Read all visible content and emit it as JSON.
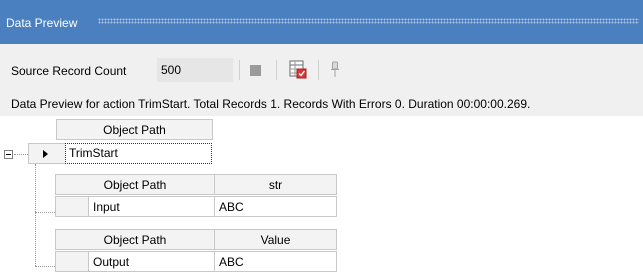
{
  "panel": {
    "title": "Data Preview"
  },
  "toolbar": {
    "source_record_count_label": "Source Record Count",
    "source_record_count_value": "500",
    "stop_icon": "stop-icon",
    "grid_icon": "grid-check-icon",
    "pin_icon": "pin-icon"
  },
  "status": {
    "message": "Data Preview for action TrimStart. Total Records 1. Records With Errors 0. Duration 00:00:00.269."
  },
  "tree": {
    "root_header": "Object Path",
    "root_row": "TrimStart",
    "children": [
      {
        "header_path": "Object Path",
        "header_value": "str",
        "path": "Input",
        "value": "ABC"
      },
      {
        "header_path": "Object Path",
        "header_value": "Value",
        "path": "Output",
        "value": "ABC"
      }
    ]
  }
}
